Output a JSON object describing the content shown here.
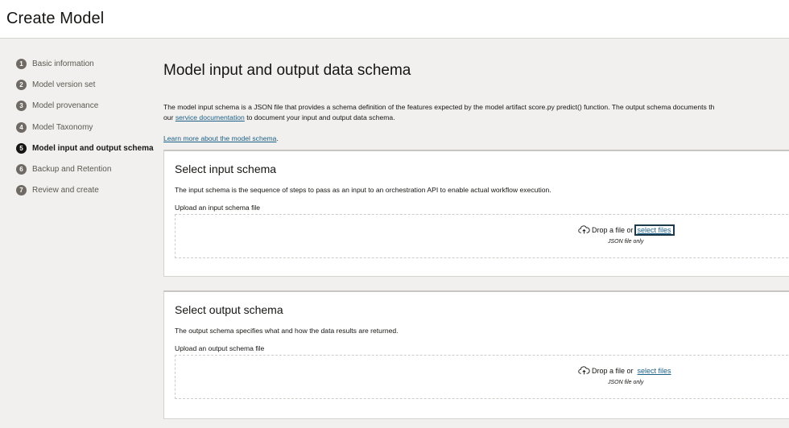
{
  "header": {
    "title": "Create Model"
  },
  "steps": [
    {
      "num": "1",
      "label": "Basic information"
    },
    {
      "num": "2",
      "label": "Model version set"
    },
    {
      "num": "3",
      "label": "Model provenance"
    },
    {
      "num": "4",
      "label": "Model Taxonomy"
    },
    {
      "num": "5",
      "label": "Model input and output schema",
      "active": true
    },
    {
      "num": "6",
      "label": "Backup and Retention"
    },
    {
      "num": "7",
      "label": "Review and create"
    }
  ],
  "main": {
    "heading": "Model input and output data schema",
    "intro_line1": "The model input schema is a JSON file that provides a schema definition of the features expected by the model artifact score.py predict() function. The output schema documents th",
    "intro_line2_prefix": "our",
    "intro_link": "service documentation",
    "intro_line2_suffix": "to document your input and output data schema.",
    "learn_more_link": "Learn more about the model schema",
    "learn_more_suffix": "."
  },
  "input_schema": {
    "title": "Select input schema",
    "description": "The input schema is the sequence of steps to pass as an input to an orchestration API to enable actual workflow execution.",
    "upload_label": "Upload an input schema file",
    "drop_text": "Drop a file or",
    "select_link": "select files",
    "hint": "JSON file only",
    "icon": "cloud-upload-icon"
  },
  "output_schema": {
    "title": "Select output schema",
    "description": "The output schema specifies what and how the data results are returned.",
    "upload_label": "Upload an output schema file",
    "drop_text": "Drop a file or",
    "select_link": "select files",
    "hint": "JSON file only",
    "icon": "cloud-upload-icon"
  },
  "colors": {
    "background": "#f1f0ee",
    "link": "#1b5f86",
    "active_step": "#161513",
    "inactive_step": "#6f6a63"
  }
}
